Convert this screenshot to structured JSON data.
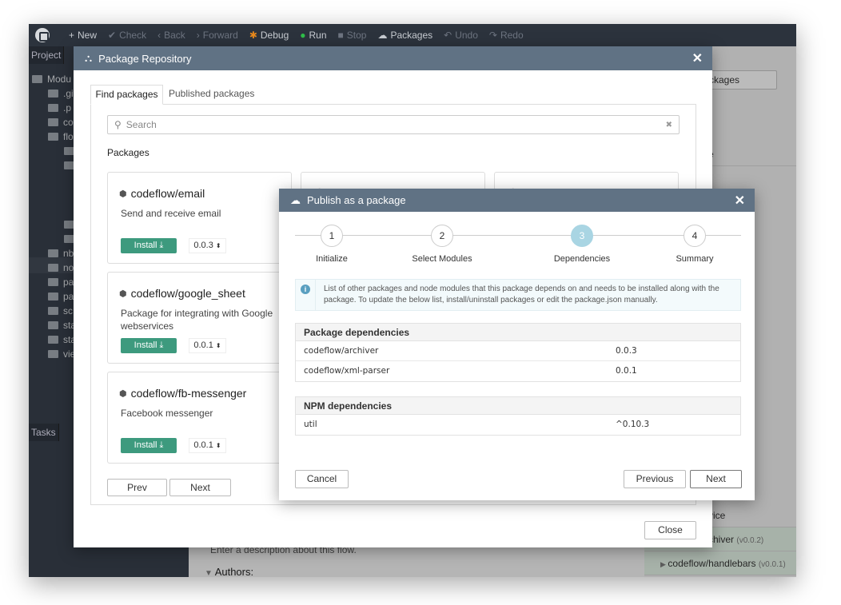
{
  "toolbar": {
    "items": [
      {
        "label": "New",
        "icon": "plus-icon",
        "enabled": true
      },
      {
        "label": "Check",
        "icon": "check-icon",
        "enabled": false
      },
      {
        "label": "Back",
        "icon": "chevron-left-icon",
        "enabled": false
      },
      {
        "label": "Forward",
        "icon": "chevron-right-icon",
        "enabled": false
      },
      {
        "label": "Debug",
        "icon": "bug-icon",
        "enabled": true
      },
      {
        "label": "Run",
        "icon": "play-icon",
        "enabled": true
      },
      {
        "label": "Stop",
        "icon": "stop-icon",
        "enabled": false
      },
      {
        "label": "Packages",
        "icon": "cloud-icon",
        "enabled": true
      },
      {
        "label": "Undo",
        "icon": "undo-icon",
        "enabled": false
      },
      {
        "label": "Redo",
        "icon": "redo-icon",
        "enabled": false
      }
    ]
  },
  "sidebar": {
    "project_tab": "Project",
    "tasks_tab": "Tasks",
    "items": [
      "Modu",
      ".git",
      ".p",
      "co",
      "flo",
      "",
      "",
      "",
      "",
      "nb",
      "no",
      "pa",
      "pa",
      "sc",
      "sta",
      "sta",
      "vie"
    ]
  },
  "background": {
    "description_hint": "Enter a description about this flow.",
    "authors_label": "Authors:",
    "right_button": "ckages",
    "right_rows": [
      "e",
      "vice",
      "chiver",
      "codeflow/handlebars"
    ],
    "right_versions": [
      "",
      "",
      "(v0.0.2)",
      "(v0.0.1)"
    ]
  },
  "repo": {
    "title": "Package Repository",
    "tabs": [
      "Find packages",
      "Published packages"
    ],
    "search_placeholder": "Search",
    "section": "Packages",
    "packages": [
      {
        "name": "codeflow/email",
        "description": "Send and receive email",
        "version": "0.0.3"
      },
      {
        "name": "codeflow/google_sheet",
        "description": "Package for integrating with Google webservices",
        "version": "0.0.1"
      },
      {
        "name": "codeflow/fb-messenger",
        "description": "Facebook messenger",
        "version": "0.0.1"
      }
    ],
    "install_label": "Install",
    "prev_label": "Prev",
    "next_label": "Next",
    "close_label": "Close"
  },
  "publish": {
    "title": "Publish as a package",
    "steps": [
      {
        "n": "1",
        "label": "Initialize"
      },
      {
        "n": "2",
        "label": "Select Modules"
      },
      {
        "n": "3",
        "label": "Dependencies"
      },
      {
        "n": "4",
        "label": "Summary"
      }
    ],
    "active_step": 3,
    "info": "List of other packages and node modules that this package depends on and needs to be installed along with the package. To update the below list, install/uninstall packages or edit the package.json manually.",
    "package_deps_title": "Package dependencies",
    "package_deps": [
      {
        "name": "codeflow/archiver",
        "version": "0.0.3"
      },
      {
        "name": "codeflow/xml-parser",
        "version": "0.0.1"
      }
    ],
    "npm_deps_title": "NPM dependencies",
    "npm_deps": [
      {
        "name": "util",
        "version": "^0.10.3"
      }
    ],
    "cancel_label": "Cancel",
    "previous_label": "Previous",
    "next_label": "Next"
  },
  "colors": {
    "toolbar": "#2c333d",
    "sidebar": "#353d48",
    "modal_header": "#607284",
    "install": "#3d9a7e",
    "active_step": "#a9d5e3"
  }
}
